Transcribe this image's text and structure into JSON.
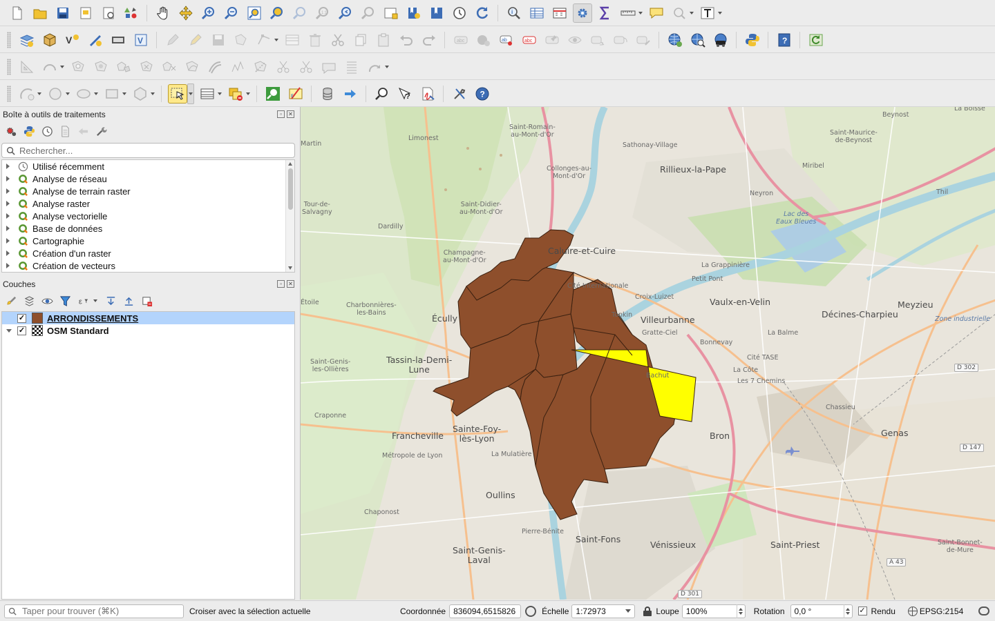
{
  "toolbars": {
    "row1": [
      "new-project",
      "open-project",
      "save-project",
      "new-print-layout",
      "layout-manager",
      "style-manager",
      "pan",
      "pan-to-selection",
      "zoom-in",
      "zoom-out",
      "zoom-full",
      "zoom-to-selection",
      "zoom-to-layer",
      "zoom-native",
      "zoom-last",
      "zoom-next",
      "new-map-view",
      "new-bookmark",
      "show-bookmarks",
      "temporal-controller",
      "refresh",
      "identify",
      "attribute-table",
      "field-calculator",
      "processing-toolbox",
      "statistical-summary",
      "measure",
      "map-tips",
      "text-annotation"
    ],
    "row2": [
      "data-source-manager",
      "new-geopackage-layer",
      "new-shapefile-layer",
      "new-spatialite-layer",
      "new-virtual-layer",
      "new-temporary-layer"
    ],
    "snapping": [
      "current-edits",
      "toggle-editing",
      "save-edits",
      "add-feature",
      "vertex-tool",
      "modify-attributes",
      "delete-selected",
      "cut",
      "copy",
      "paste",
      "undo",
      "redo"
    ],
    "labels": [
      "layer-labeling",
      "layer-diagram",
      "highlight-pinned-labels",
      "toggle-label-display",
      "pin-labels",
      "show-hide-labels",
      "move-label",
      "rotate-label",
      "change-label"
    ],
    "plugins": [
      "osm-place-search",
      "query-osm",
      "geocode",
      "python-console",
      "help",
      "plugin-reloader"
    ]
  },
  "processing": {
    "title": "Boîte à outils de traitements",
    "search_placeholder": "Rechercher...",
    "items": [
      {
        "label": "Utilisé récemment",
        "icon": "clock-icon"
      },
      {
        "label": "Analyse de réseau",
        "icon": "qgis-icon"
      },
      {
        "label": "Analyse de terrain raster",
        "icon": "qgis-icon"
      },
      {
        "label": "Analyse raster",
        "icon": "qgis-icon"
      },
      {
        "label": "Analyse vectorielle",
        "icon": "qgis-icon"
      },
      {
        "label": "Base de données",
        "icon": "qgis-icon"
      },
      {
        "label": "Cartographie",
        "icon": "qgis-icon"
      },
      {
        "label": "Création d'un raster",
        "icon": "qgis-icon"
      },
      {
        "label": "Création de vecteurs",
        "icon": "qgis-icon"
      }
    ]
  },
  "layers_panel": {
    "title": "Couches",
    "layers": [
      {
        "name": "ARRONDISSEMENTS",
        "checked": true,
        "selected": true,
        "swatch": "#8e4f2c"
      },
      {
        "name": "OSM Standard",
        "checked": true,
        "selected": false,
        "expanded": true
      }
    ]
  },
  "map": {
    "fill_brown": "#8e4f2c",
    "fill_yellow": "#ffff00",
    "labels": {
      "l1": "La Boisse",
      "l2": "Beynost",
      "l3": "Saint-Maurice-\nde-Beynost",
      "l4": "Martin",
      "l5": "Saint-Romain-\nau-Mont-d'Or",
      "l6": "Limonest",
      "l7": "Sathonay-Village",
      "l8": "Rillieux-la-Pape",
      "l9": "Miribel",
      "l10": "Thil",
      "l11": "Collonges-au-\nMont-d'Or",
      "l12": "Neyron",
      "l13": "Tour-de-\nSalvagny",
      "l14": "Saint-Didier-\nau-Mont-d'Or",
      "l15": "Dardilly",
      "l16": "Lac des\nEaux Bleues",
      "l17": "Métropole de Lyon",
      "l18": "Champagne-\nau-Mont-d'Or",
      "l19": "Caluire-et-Cuire",
      "l20": "La Grappinière",
      "l21": "Petit Pont",
      "l22": "Cité Internationale",
      "l23": "Croix-Luizet",
      "l24": "Vaulx-en-Velin",
      "l25": "Meyzieu",
      "l26": "Charbonnières-\nles-Bains",
      "l27": "Écully",
      "l28": "Villeurbanne",
      "l29": "Décines-Charpieu",
      "l30": "Zone industrielle",
      "l31": "Gratte-Ciel",
      "l32": "Bonnevay",
      "l33": "La Balme",
      "l34": "Saint-Genis-\nles-Ollières",
      "l35": "Tassin-la-Demi-\nLune",
      "l36": "Cité TASE",
      "l37": "La Côte",
      "l38": "Les 7 Chemins",
      "l39": "Chassieu",
      "l40": "Craponne",
      "l41": "Sainte-Foy-\nlès-Lyon",
      "l42": "Francheville",
      "l43": "Bron",
      "l44": "Genas",
      "l45": "La Mulatière",
      "l46": "Oullins",
      "l47": "Chaponost",
      "l48": "Pierre-Bénite",
      "l49": "Saint-Fons",
      "l50": "Vénissieux",
      "l51": "Saint-Priest",
      "l52": "Saint-Genis-\nLaval",
      "l53": "Saint-Bonnet-\nde-Mure",
      "l54": "Tonkin",
      "l55": "Bachut",
      "l56": "Étoile"
    },
    "roads": {
      "r1": "D 302",
      "r2": "D 147",
      "r3": "A 43",
      "r4": "D 301"
    }
  },
  "statusbar": {
    "locator_placeholder": "Taper pour trouver (⌘K)",
    "message": "Croiser avec la sélection actuelle",
    "coord_label": "Coordonnée",
    "coord_value": "836094,6515826",
    "scale_label": "Échelle",
    "scale_value": "1:72973",
    "magnifier_label": "Loupe",
    "magnifier_value": "100%",
    "rotation_label": "Rotation",
    "rotation_value": "0,0 °",
    "render_label": "Rendu",
    "render_checked": true,
    "crs": "EPSG:2154"
  }
}
